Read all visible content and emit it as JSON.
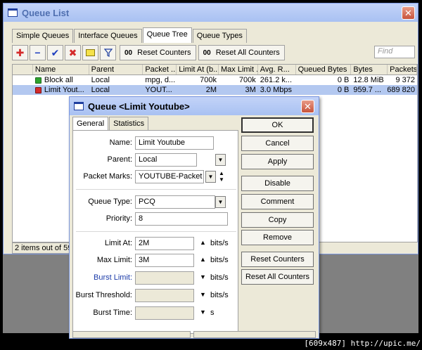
{
  "window": {
    "title": "Queue List",
    "close": "✕"
  },
  "tabs": [
    {
      "label": "Simple Queues"
    },
    {
      "label": "Interface Queues"
    },
    {
      "label": "Queue Tree"
    },
    {
      "label": "Queue Types"
    }
  ],
  "toolbar": {
    "add": "✚",
    "remove": "−",
    "enable": "✔",
    "disable": "✖",
    "comment": "",
    "filter": "",
    "reset_counters": "Reset Counters",
    "reset_all_counters": "Reset All Counters",
    "reset_icon": "00",
    "find_placeholder": "Find"
  },
  "table": {
    "headers": [
      "",
      "Name",
      "Parent",
      "Packet ...",
      "Limit At (b...",
      "Max Limit ...",
      "Avg. R...",
      "Queued Bytes",
      "Bytes",
      "Packets"
    ],
    "rows": [
      {
        "name": "Block all",
        "parent": "Local",
        "packet_marks": "mpg, d...",
        "limit_at": "700k",
        "max_limit": "700k",
        "avg_rate": "261.2 k...",
        "queued_bytes": "0 B",
        "bytes": "12.8 MiB",
        "packets": "9 372",
        "icon_color": "#2ea32e"
      },
      {
        "name": "Limit Yout...",
        "parent": "Local",
        "packet_marks": "YOUT...",
        "limit_at": "2M",
        "max_limit": "3M",
        "avg_rate": "3.0 Mbps",
        "queued_bytes": "0 B",
        "bytes": "959.7 ...",
        "packets": "689 820",
        "icon_color": "#d42b2b"
      }
    ]
  },
  "status": "2 items out of 59 (",
  "dialog": {
    "title": "Queue <Limit Youtube>",
    "close": "✕",
    "tabs": [
      {
        "label": "General"
      },
      {
        "label": "Statistics"
      }
    ],
    "fields": {
      "name_label": "Name:",
      "name_value": "Limit Youtube",
      "parent_label": "Parent:",
      "parent_value": "Local",
      "packet_marks_label": "Packet Marks:",
      "packet_marks_value": "YOUTUBE-Packet",
      "queue_type_label": "Queue Type:",
      "queue_type_value": "PCQ",
      "priority_label": "Priority:",
      "priority_value": "8",
      "limit_at_label": "Limit At:",
      "limit_at_value": "2M",
      "max_limit_label": "Max Limit:",
      "max_limit_value": "3M",
      "burst_limit_label": "Burst Limit:",
      "burst_limit_value": "",
      "burst_threshold_label": "Burst Threshold:",
      "burst_threshold_value": "",
      "burst_time_label": "Burst Time:",
      "burst_time_value": "",
      "unit_bits": "bits/s",
      "unit_s": "s"
    },
    "buttons": {
      "ok": "OK",
      "cancel": "Cancel",
      "apply": "Apply",
      "disable": "Disable",
      "comment": "Comment",
      "copy": "Copy",
      "remove": "Remove",
      "reset_counters": "Reset Counters",
      "reset_all_counters": "Reset All Counters"
    }
  },
  "watermark": "[609x487] http://upic.me/"
}
